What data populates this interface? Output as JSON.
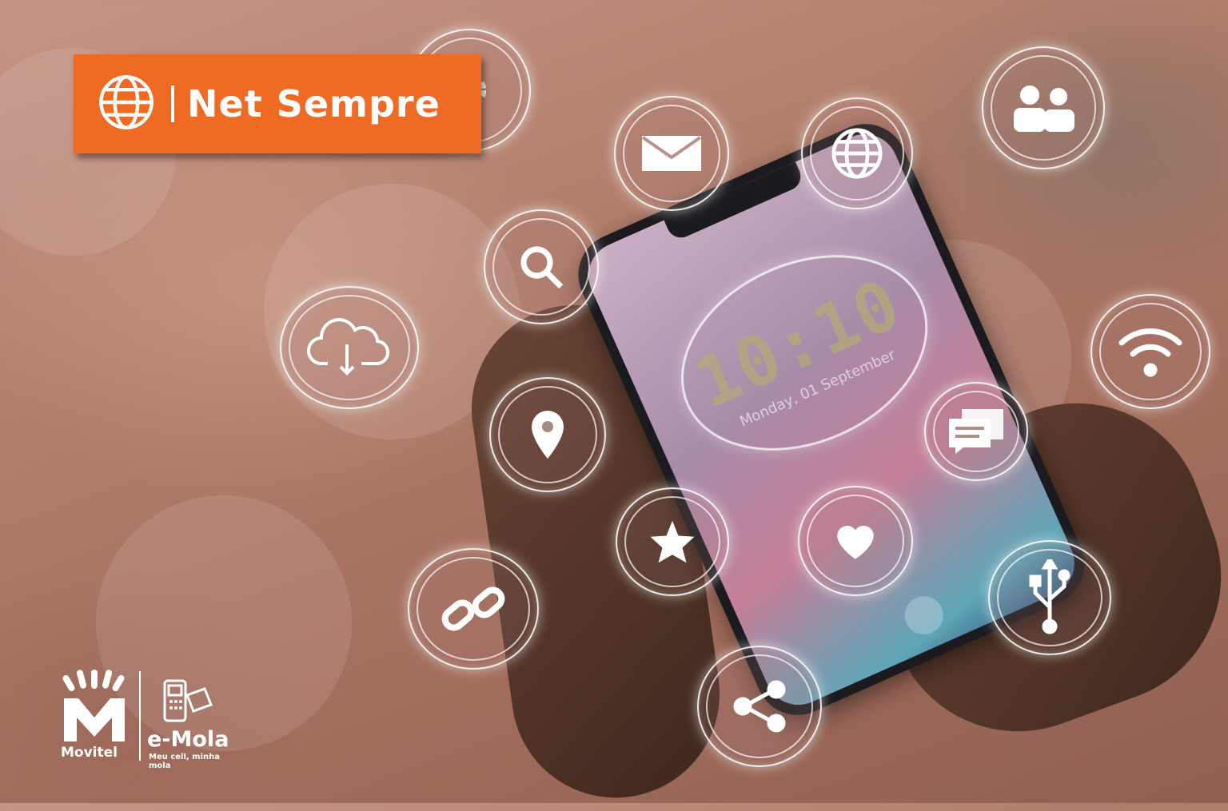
{
  "banner": {
    "title": "Net Sempre",
    "icon": "globe-icon",
    "color": "#ef6a22"
  },
  "phone": {
    "clock_time": "10:10",
    "clock_date": "Monday, 01 September"
  },
  "icons": [
    "gear-icon",
    "mail-icon",
    "globe-icon",
    "people-icon",
    "search-icon",
    "cloud-download-icon",
    "wifi-icon",
    "location-pin-icon",
    "chat-icon",
    "star-icon",
    "heart-icon",
    "link-icon",
    "usb-icon",
    "share-icon"
  ],
  "brand": {
    "movitel": "Movitel",
    "emola": "e-Mola",
    "emola_tagline": "Meu cell, minha mola"
  }
}
